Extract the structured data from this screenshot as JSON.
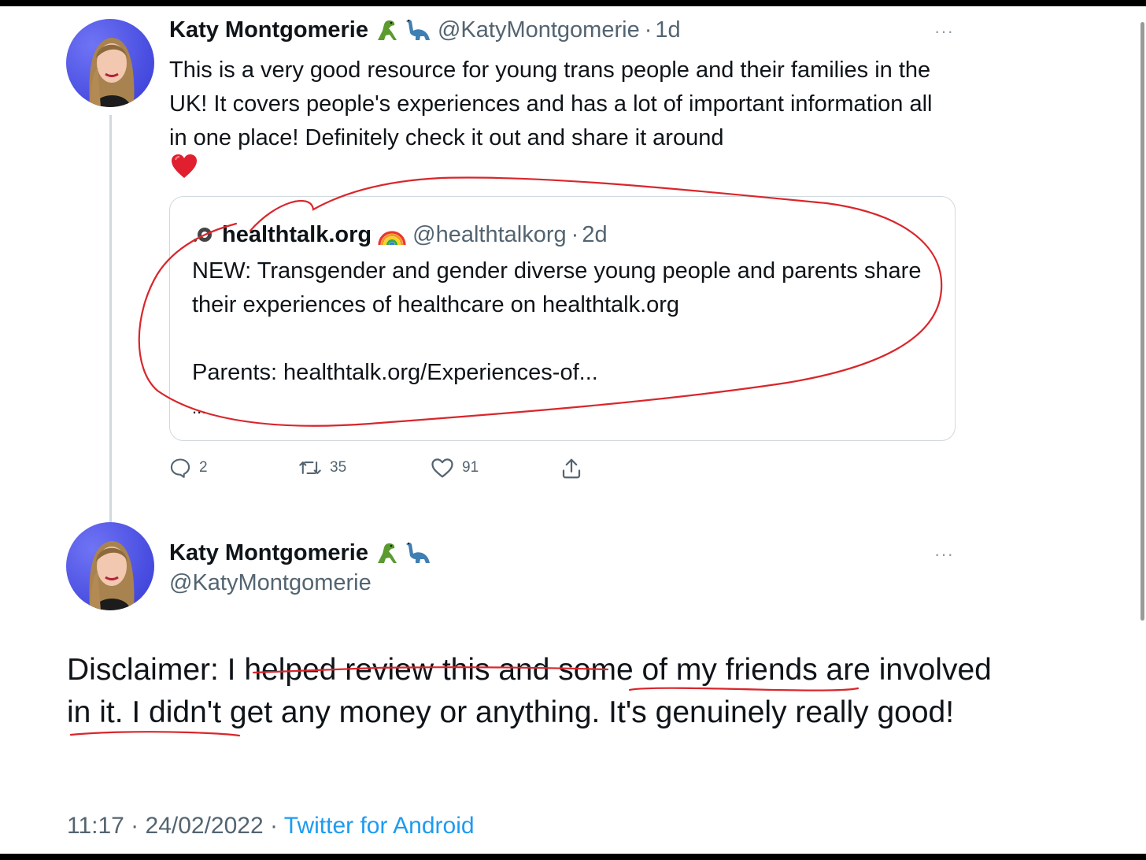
{
  "tweet1": {
    "display_name": "Katy Montgomerie",
    "handle": "@KatyMontgomerie",
    "time": "1d",
    "text": "This is a very good resource for young trans people and their families in the UK! It covers people's experiences and has a lot of important information all in one place! Definitely check it out and share it around",
    "more_label": "···",
    "quote": {
      "display_name": "healthtalk.org",
      "handle": "@healthtalkorg",
      "time": "2d",
      "text_line1": "NEW: Transgender and gender diverse young people and parents share their experiences of healthcare on healthtalk.org",
      "text_line2": "Parents: healthtalk.org/Experiences-of...",
      "ellipsis": "..."
    },
    "actions": {
      "reply_count": "2",
      "retweet_count": "35",
      "like_count": "91"
    }
  },
  "tweet2": {
    "display_name": "Katy Montgomerie",
    "handle": "@KatyMontgomerie",
    "more_label": "···",
    "text": "Disclaimer: I helped review this and some of my friends are involved in it. I didn't get any money or anything. It's genuinely really good!",
    "timestamp": "11:17 · 24/02/2022",
    "separator": "·",
    "source": "Twitter for Android"
  },
  "colors": {
    "text": "#0f1419",
    "secondary": "#536471",
    "link": "#1d9bf0",
    "annotation": "#d9262b",
    "border": "#cfd9de"
  },
  "icons": [
    "dinosaur-icon",
    "sauropod-icon",
    "heart-emoji-icon",
    "rainbow-icon",
    "reply-icon",
    "retweet-icon",
    "like-icon",
    "share-icon",
    "more-icon"
  ]
}
